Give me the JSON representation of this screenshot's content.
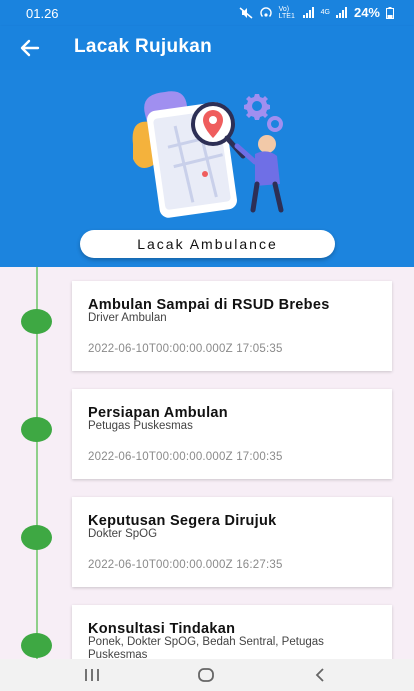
{
  "status": {
    "time": "01.26",
    "network": "Vo) LTE1",
    "network2": "4G",
    "battery": "24%"
  },
  "app_bar": {
    "title": "Lacak Rujukan"
  },
  "hero": {
    "button_label": "Lacak Ambulance"
  },
  "timeline": [
    {
      "title": "Ambulan Sampai di RSUD Brebes",
      "actor": "Driver Ambulan",
      "time": "2022-06-10T00:00:00.000Z 17:05:35"
    },
    {
      "title": "Persiapan Ambulan",
      "actor": "Petugas Puskesmas",
      "time": "2022-06-10T00:00:00.000Z 17:00:35"
    },
    {
      "title": "Keputusan Segera Dirujuk",
      "actor": "Dokter SpOG",
      "time": "2022-06-10T00:00:00.000Z 16:27:35"
    },
    {
      "title": "Konsultasi Tindakan",
      "actor": "Ponek, Dokter SpOG, Bedah Sentral, Petugas Puskesmas",
      "time": ""
    }
  ],
  "colors": {
    "primary": "#1a83de",
    "dot": "#3ea843",
    "line": "#8fcf8a",
    "background": "#f7eef6"
  }
}
